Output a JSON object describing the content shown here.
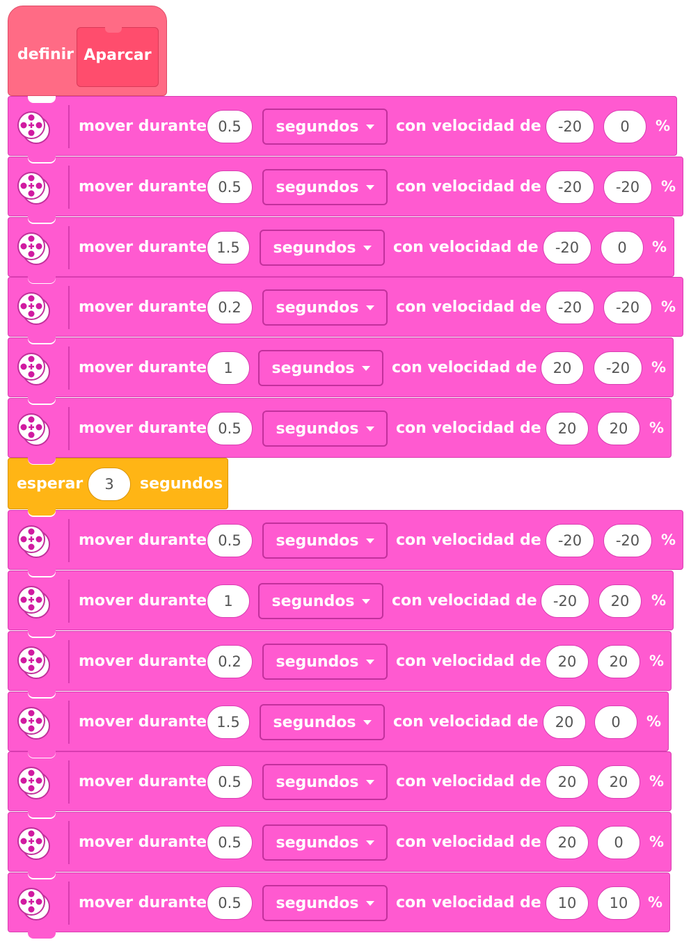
{
  "definition": {
    "keyword": "definir",
    "name": "Aparcar"
  },
  "blocks": [
    {
      "type": "move",
      "verb": "mover durante",
      "duration": "0.5",
      "unit": "segundos",
      "speed_label": "con velocidad de",
      "left": "-20",
      "right": "0",
      "pct": "%"
    },
    {
      "type": "move",
      "verb": "mover durante",
      "duration": "0.5",
      "unit": "segundos",
      "speed_label": "con velocidad de",
      "left": "-20",
      "right": "-20",
      "pct": "%"
    },
    {
      "type": "move",
      "verb": "mover durante",
      "duration": "1.5",
      "unit": "segundos",
      "speed_label": "con velocidad de",
      "left": "-20",
      "right": "0",
      "pct": "%"
    },
    {
      "type": "move",
      "verb": "mover durante",
      "duration": "0.2",
      "unit": "segundos",
      "speed_label": "con velocidad de",
      "left": "-20",
      "right": "-20",
      "pct": "%"
    },
    {
      "type": "move",
      "verb": "mover durante",
      "duration": "1",
      "unit": "segundos",
      "speed_label": "con velocidad de",
      "left": "20",
      "right": "-20",
      "pct": "%"
    },
    {
      "type": "move",
      "verb": "mover durante",
      "duration": "0.5",
      "unit": "segundos",
      "speed_label": "con velocidad de",
      "left": "20",
      "right": "20",
      "pct": "%"
    },
    {
      "type": "wait",
      "verb": "esperar",
      "duration": "3",
      "unit": "segundos"
    },
    {
      "type": "move",
      "verb": "mover durante",
      "duration": "0.5",
      "unit": "segundos",
      "speed_label": "con velocidad de",
      "left": "-20",
      "right": "-20",
      "pct": "%"
    },
    {
      "type": "move",
      "verb": "mover durante",
      "duration": "1",
      "unit": "segundos",
      "speed_label": "con velocidad de",
      "left": "-20",
      "right": "20",
      "pct": "%"
    },
    {
      "type": "move",
      "verb": "mover durante",
      "duration": "0.2",
      "unit": "segundos",
      "speed_label": "con velocidad de",
      "left": "20",
      "right": "20",
      "pct": "%"
    },
    {
      "type": "move",
      "verb": "mover durante",
      "duration": "1.5",
      "unit": "segundos",
      "speed_label": "con velocidad de",
      "left": "20",
      "right": "0",
      "pct": "%"
    },
    {
      "type": "move",
      "verb": "mover durante",
      "duration": "0.5",
      "unit": "segundos",
      "speed_label": "con velocidad de",
      "left": "20",
      "right": "20",
      "pct": "%"
    },
    {
      "type": "move",
      "verb": "mover durante",
      "duration": "0.5",
      "unit": "segundos",
      "speed_label": "con velocidad de",
      "left": "20",
      "right": "0",
      "pct": "%"
    },
    {
      "type": "move",
      "verb": "mover durante",
      "duration": "0.5",
      "unit": "segundos",
      "speed_label": "con velocidad de",
      "left": "10",
      "right": "10",
      "pct": "%"
    }
  ],
  "colors": {
    "motor_block": "#ff5ad0",
    "wait_block": "#ffb515",
    "define_block": "#ff6b85"
  },
  "icons": {
    "motor": "move-pair-icon"
  }
}
